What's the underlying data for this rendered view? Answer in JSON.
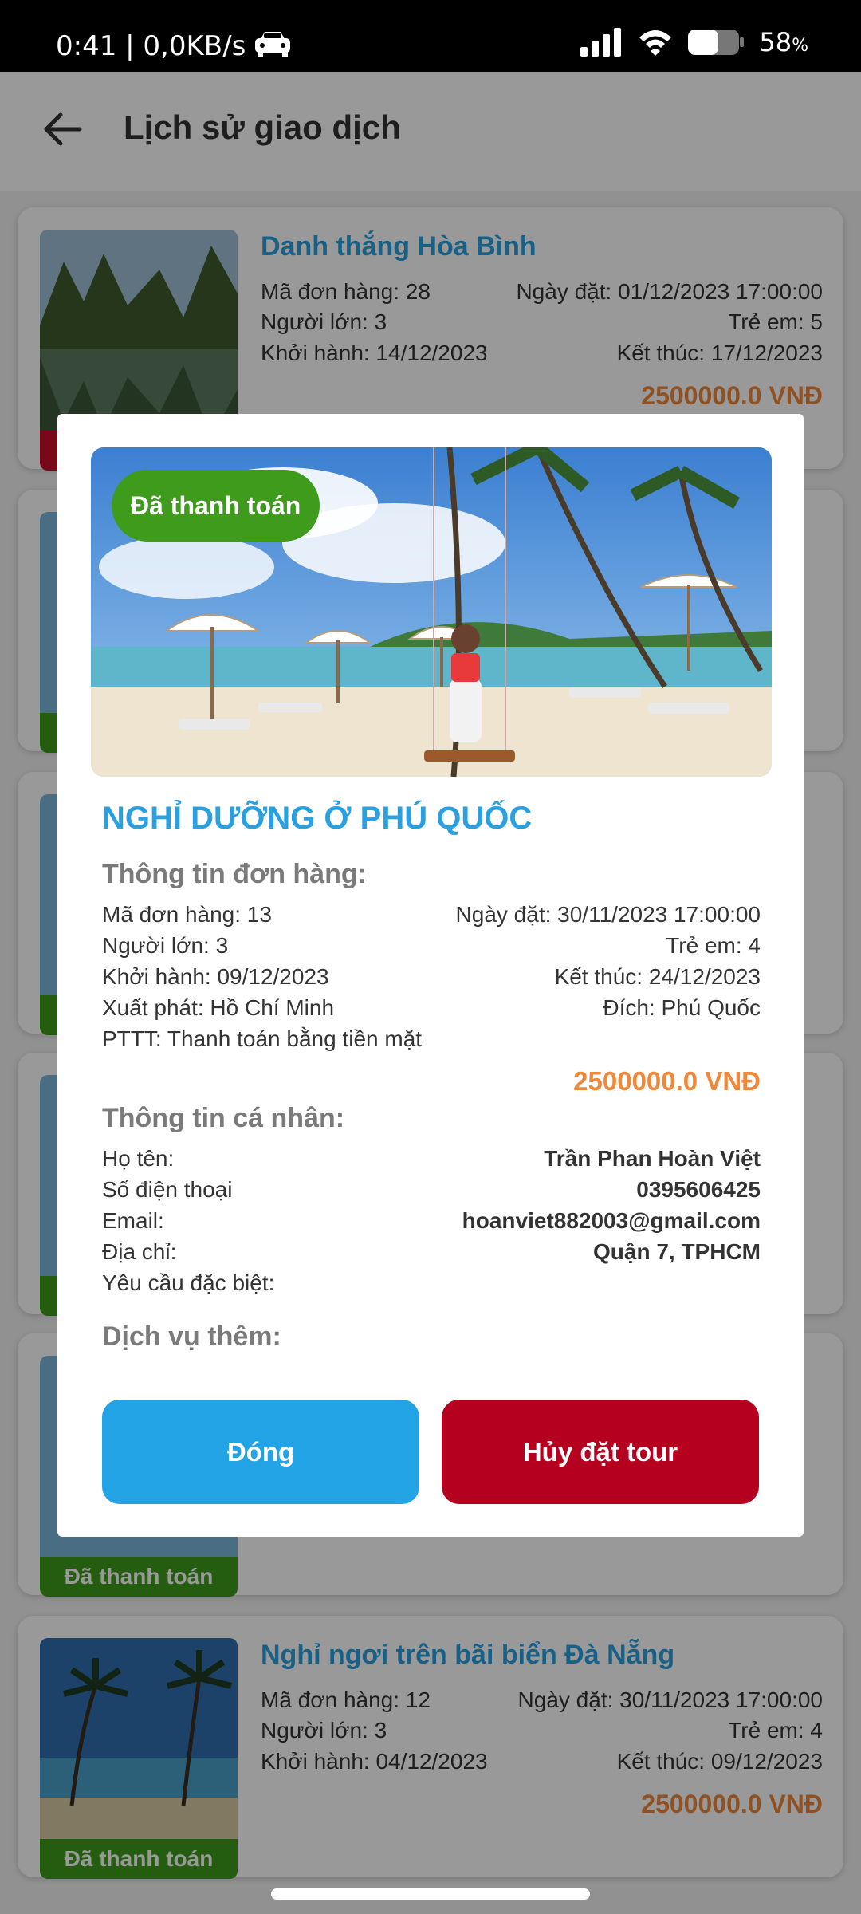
{
  "status_bar": {
    "time": "0:41 | 0,0KB/s",
    "battery": "58",
    "battery_unit": "%",
    "icons": [
      "car-icon",
      "signal-icon",
      "wifi-icon",
      "battery-icon"
    ]
  },
  "header": {
    "title": "Lịch sử giao dịch"
  },
  "list": [
    {
      "title": "Danh thắng Hòa Bình",
      "order_id": "Mã đơn hàng: 28",
      "order_date": "Ngày đặt: 01/12/2023 17:00:00",
      "adults": "Người lớn: 3",
      "children": "Trẻ em: 5",
      "start": "Khởi hành: 14/12/2023",
      "end": "Kết thúc: 17/12/2023",
      "price": "2500000.0 VNĐ"
    },
    {
      "badge": "Đã thanh toán"
    },
    {
      "title": "Nghỉ ngơi trên bãi biển Đà Nẵng",
      "order_id": "Mã đơn hàng: 12",
      "order_date": "Ngày đặt: 30/11/2023 17:00:00",
      "adults": "Người lớn: 3",
      "children": "Trẻ em: 4",
      "start": "Khởi hành: 04/12/2023",
      "end": "Kết thúc: 09/12/2023",
      "price": "2500000.0 VNĐ",
      "badge": "Đã thanh toán"
    }
  ],
  "dialog": {
    "badge": "Đã thanh toán",
    "title": "NGHỈ DƯỠNG Ở PHÚ QUỐC",
    "order_section": "Thông tin đơn hàng:",
    "order_id": "Mã đơn hàng: 13",
    "order_date": "Ngày đặt: 30/11/2023 17:00:00",
    "adults": "Người lớn: 3",
    "children": "Trẻ em: 4",
    "start": "Khởi hành: 09/12/2023",
    "end": "Kết thúc: 24/12/2023",
    "from": "Xuất phát: Hồ Chí Minh",
    "to": "Đích: Phú Quốc",
    "payment": "PTTT: Thanh toán bằng tiền mặt",
    "price": "2500000.0 VNĐ",
    "personal_section": "Thông tin cá nhân:",
    "name_label": "Họ tên:",
    "name_value": "Trần Phan Hoàn Việt",
    "phone_label": "Số điện thoại",
    "phone_value": "0395606425",
    "email_label": "Email:",
    "email_value": "hoanviet882003@gmail.com",
    "address_label": "Địa chỉ:",
    "address_value": "Quận 7, TPHCM",
    "request_label": "Yêu cầu đặc biệt:",
    "services_section": "Dịch vụ thêm:",
    "close_button": "Đóng",
    "cancel_button": "Hủy đặt tour"
  }
}
